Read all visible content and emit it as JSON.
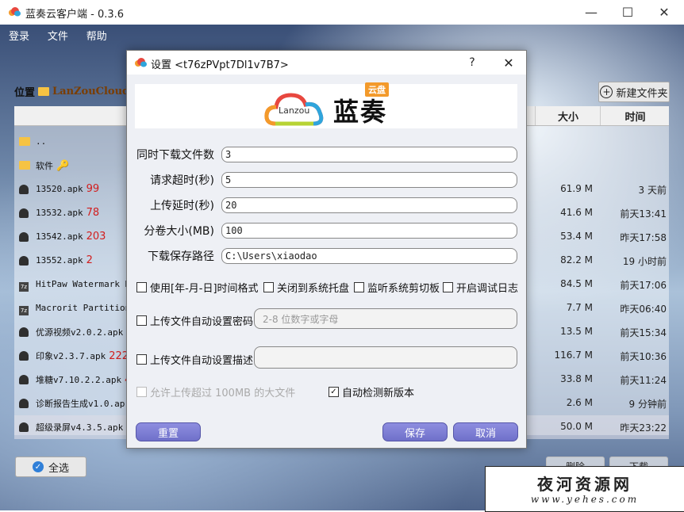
{
  "window": {
    "title": "蓝奏云客户端 - 0.3.6",
    "controls": {
      "minimize": "—",
      "maximize": "☐",
      "close": "✕"
    }
  },
  "menu": [
    "登录",
    "文件",
    "帮助"
  ],
  "location": {
    "label": "位置",
    "path": "LanZouCloud"
  },
  "toolbar": {
    "new_folder": "新建文件夹",
    "select_all": "全选",
    "delete": "删除",
    "download": "下载"
  },
  "table": {
    "headers": {
      "size": "大小",
      "time": "时间"
    },
    "rows": [
      {
        "icon": "folder-icon",
        "name": "..",
        "note": "",
        "size": "",
        "time": ""
      },
      {
        "icon": "folder-icon",
        "name": "软件",
        "note": "🔑",
        "size": "",
        "time": ""
      },
      {
        "icon": "android-icon",
        "name": "13520.apk",
        "note": "99",
        "size": "61.9 M",
        "time": "3 天前"
      },
      {
        "icon": "android-icon",
        "name": "13532.apk",
        "note": "78",
        "size": "41.6 M",
        "time": "前天13:41"
      },
      {
        "icon": "android-icon",
        "name": "13542.apk",
        "note": "203",
        "size": "53.4 M",
        "time": "昨天17:58"
      },
      {
        "icon": "android-icon",
        "name": "13552.apk",
        "note": "2",
        "size": "82.2 M",
        "time": "19 小时前"
      },
      {
        "icon": "zip-icon",
        "name": "HitPaw Watermark Re",
        "note": "",
        "size": "84.5 M",
        "time": "前天17:06"
      },
      {
        "icon": "zip-icon",
        "name": "Macrorit Partition",
        "note": "",
        "size": "7.7 M",
        "time": "昨天06:40"
      },
      {
        "icon": "android-icon",
        "name": "优源视频v2.0.2.apk",
        "note": "",
        "size": "13.5 M",
        "time": "前天15:34"
      },
      {
        "icon": "android-icon",
        "name": "印象v2.3.7.apk",
        "note": "222",
        "size": "116.7 M",
        "time": "前天10:36"
      },
      {
        "icon": "android-icon",
        "name": "堆糖v7.10.2.2.apk",
        "note": "4",
        "size": "33.8 M",
        "time": "前天11:24"
      },
      {
        "icon": "android-icon",
        "name": "诊断报告生成v1.0.ap",
        "note": "",
        "size": "2.6 M",
        "time": "9 分钟前"
      },
      {
        "icon": "android-icon",
        "name": "超级录屏v4.3.5.apk",
        "note": "",
        "size": "50.0 M",
        "time": "昨天23:22"
      }
    ]
  },
  "dialog": {
    "title": "设置 <t76zPVpt7Dl1v7B7>",
    "help": "?",
    "close": "✕",
    "logo": {
      "cloud_text": "Lanzou",
      "brand": "蓝奏",
      "badge": "云盘"
    },
    "fields": [
      {
        "label": "同时下载文件数",
        "value": "3"
      },
      {
        "label": "请求超时(秒)",
        "value": "5"
      },
      {
        "label": "上传延时(秒)",
        "value": "20"
      },
      {
        "label": "分卷大小(MB)",
        "value": "100"
      },
      {
        "label": "下载保存路径",
        "value": "C:\\Users\\xiaodao"
      }
    ],
    "checks": {
      "date_format": {
        "label": "使用[年-月-日]时间格式",
        "checked": false
      },
      "no_tray": {
        "label": "关闭到系统托盘",
        "checked": false
      },
      "clipboard": {
        "label": "监听系统剪切板",
        "checked": false
      },
      "debug_log": {
        "label": "开启调试日志",
        "checked": false
      },
      "auto_pwd": {
        "label": "上传文件自动设置密码",
        "checked": false
      },
      "auto_desc": {
        "label": "上传文件自动设置描述",
        "checked": false
      },
      "allow_big": {
        "label": "允许上传超过 100MB 的大文件",
        "checked": false
      },
      "auto_update": {
        "label": "自动检测新版本",
        "checked": true
      }
    },
    "password_placeholder": "2-8 位数字或字母",
    "buttons": {
      "reset": "重置",
      "save": "保存",
      "cancel": "取消"
    }
  },
  "watermark": {
    "title": "夜河资源网",
    "url": "www.yehes.com"
  },
  "colors": {
    "note_red": "#d21d1d",
    "button_purple": "#6f70c9",
    "folder_yellow": "#f6c343"
  }
}
